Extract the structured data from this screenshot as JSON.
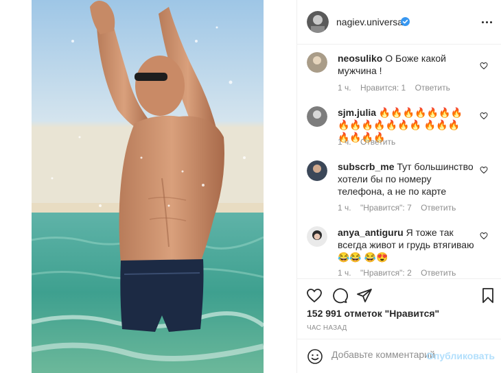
{
  "post": {
    "author": "nagiev.universal",
    "likes_text": "152 991 отметок \"Нравится\"",
    "time_text": "ЧАС НАЗАД"
  },
  "comments": [
    {
      "user": "neosuliko",
      "text": "О Боже какой мужчина !",
      "time": "1 ч.",
      "likes": "Нравится: 1",
      "reply": "Ответить"
    },
    {
      "user": "sjm.julia",
      "text": "🔥🔥🔥🔥🔥🔥🔥 🔥🔥🔥🔥🔥🔥🔥 🔥🔥🔥🔥🔥🔥🔥",
      "time": "1 ч.",
      "reply": "Ответить"
    },
    {
      "user": "subscrb_me",
      "text": "Тут большинство хотели бы по номеру телефона, а не по карте",
      "time": "1 ч.",
      "likes": "\"Нравится\": 7",
      "reply": "Ответить"
    },
    {
      "user": "anya_antiguru",
      "text": "Я тоже так всегда живот и грудь втягиваю😂😂 😂😍",
      "time": "1 ч.",
      "likes": "\"Нравится\": 2",
      "reply": "Ответить"
    }
  ],
  "add_comment": {
    "placeholder": "Добавьте комментарий...",
    "post_label": "Опубликовать"
  },
  "colors": {
    "verified": "#3897f0",
    "fire": "#f26a1b",
    "sea": "#2f9a8a"
  }
}
